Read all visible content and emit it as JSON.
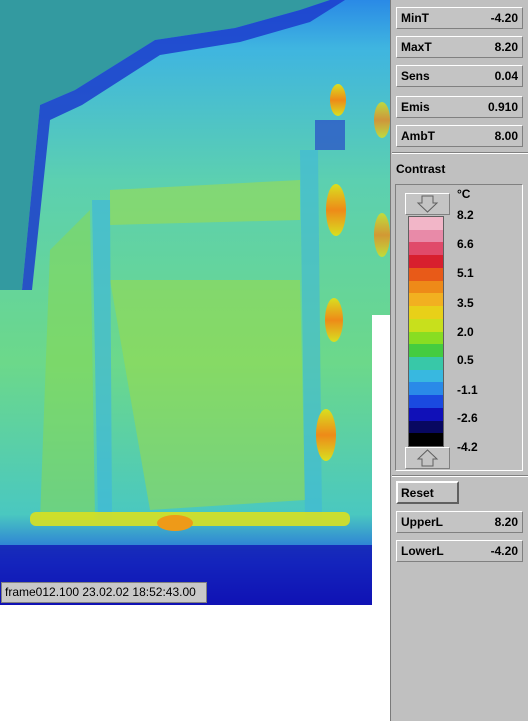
{
  "frame": {
    "label": "frame012.100   23.02.02  18:52:43.00"
  },
  "params": [
    {
      "key": "mint",
      "label": "MinT",
      "value": "-4.20"
    },
    {
      "key": "maxt",
      "label": "MaxT",
      "value": "8.20"
    },
    {
      "key": "sens",
      "label": "Sens",
      "value": "0.04"
    },
    {
      "key": "emis",
      "label": "Emis",
      "value": "0.910"
    },
    {
      "key": "ambt",
      "label": "AmbT",
      "value": "8.00"
    }
  ],
  "contrast": {
    "title": "Contrast",
    "unit": "°C",
    "ticks": [
      "8.2",
      "6.6",
      "5.1",
      "3.5",
      "2.0",
      "0.5",
      "-1.1",
      "-2.6",
      "-4.2"
    ],
    "colors": [
      "#f2b6c8",
      "#e88aa8",
      "#e04a6a",
      "#d81f2e",
      "#e85a18",
      "#ee8a18",
      "#f2b020",
      "#e8d018",
      "#c8e01c",
      "#88dd22",
      "#44cc40",
      "#38c8a8",
      "#38b8e0",
      "#2a8ae8",
      "#1a4ae0",
      "#1010b8",
      "#080860",
      "#000000"
    ]
  },
  "reset": {
    "label": "Reset"
  },
  "limits": [
    {
      "key": "upper",
      "label": "UpperL",
      "value": "8.20"
    },
    {
      "key": "lower",
      "label": "LowerL",
      "value": "-4.20"
    }
  ]
}
